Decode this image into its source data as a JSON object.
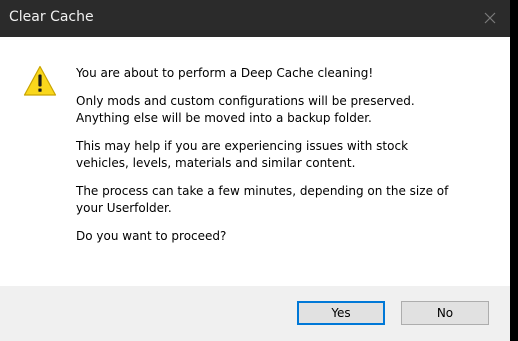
{
  "window": {
    "title": "Clear Cache",
    "close_icon": "close-icon"
  },
  "message": {
    "icon": "warning-icon",
    "paragraphs": [
      "You are about to perform a Deep Cache cleaning!",
      "Only mods and custom configurations will be preserved.\nAnything else will be moved into a backup folder.",
      "This may help if you are experiencing issues with stock\nvehicles, levels, materials and similar content.",
      "The process can take a few minutes, depending on the size of\nyour Userfolder.",
      "Do you want to proceed?"
    ]
  },
  "buttons": {
    "yes_label": "Yes",
    "no_label": "No"
  },
  "colors": {
    "titlebar": "#2b2b2b",
    "footer": "#f0f0f0",
    "default_button_border": "#0078d7",
    "warning_fill": "#f9d71c"
  }
}
